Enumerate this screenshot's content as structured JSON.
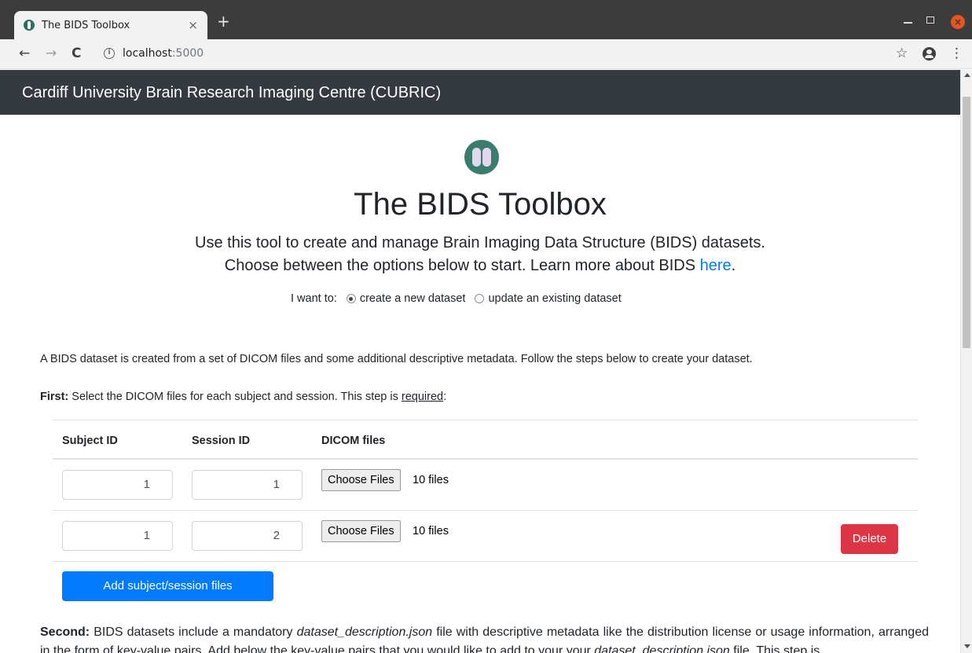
{
  "browser": {
    "tab_title": "The BIDS Toolbox",
    "tab_close": "×",
    "new_tab": "+",
    "back": "←",
    "forward": "→",
    "reload": "C",
    "url_host": "localhost",
    "url_port": ":5000",
    "info_glyph": "i",
    "bookmark": "☆",
    "menu": "⋮",
    "close_window": "×",
    "icons": [
      "favicon-icon",
      "close-icon",
      "plus-icon",
      "back-arrow-icon",
      "forward-arrow-icon",
      "reload-icon",
      "info-icon",
      "star-icon",
      "profile-icon",
      "kebab-menu-icon"
    ]
  },
  "navbar": {
    "brand": "Cardiff University Brain Research Imaging Centre (CUBRIC)"
  },
  "header": {
    "logo_icon": "brain-logo-icon",
    "title": "The BIDS Toolbox",
    "lead_1": "Use this tool to create and manage Brain Imaging Data Structure (BIDS) datasets.",
    "lead_2_prefix": "Choose between the options below to start. Learn more about BIDS ",
    "lead_2_link": "here",
    "lead_2_suffix": "."
  },
  "mode": {
    "label": "I want to:",
    "options": [
      {
        "label": "create a new dataset",
        "checked": true
      },
      {
        "label": "update an existing dataset",
        "checked": false
      }
    ]
  },
  "intro": "A BIDS dataset is created from a set of DICOM files and some additional descriptive metadata. Follow the steps below to create your dataset.",
  "first_step": {
    "bold": "First:",
    "text": " Select the DICOM files for each subject and session. This step is ",
    "underlined": "required",
    "suffix": ":"
  },
  "table": {
    "headers": [
      "Subject ID",
      "Session ID",
      "DICOM files"
    ],
    "rows": [
      {
        "subject": "1",
        "session": "1",
        "choose_label": "Choose Files",
        "files": "10 files",
        "delete_label": ""
      },
      {
        "subject": "1",
        "session": "2",
        "choose_label": "Choose Files",
        "files": "10 files",
        "delete_label": "Delete"
      }
    ]
  },
  "add_button": "Add subject/session files",
  "second_step": {
    "bold": "Second:",
    "text_1": " BIDS datasets include a mandatory ",
    "italic_1": "dataset_description.json",
    "text_2": " file with descriptive metadata like the distribution license or usage information, arranged in the form of key-value pairs. Add below the key-value pairs that you would like to add to your your ",
    "italic_2": "dataset_description.json",
    "text_3": " file. This step is"
  },
  "colors": {
    "navbar": "#343a40",
    "primary": "#007bff",
    "danger": "#dc3545",
    "logo": "#3a7d6e"
  }
}
